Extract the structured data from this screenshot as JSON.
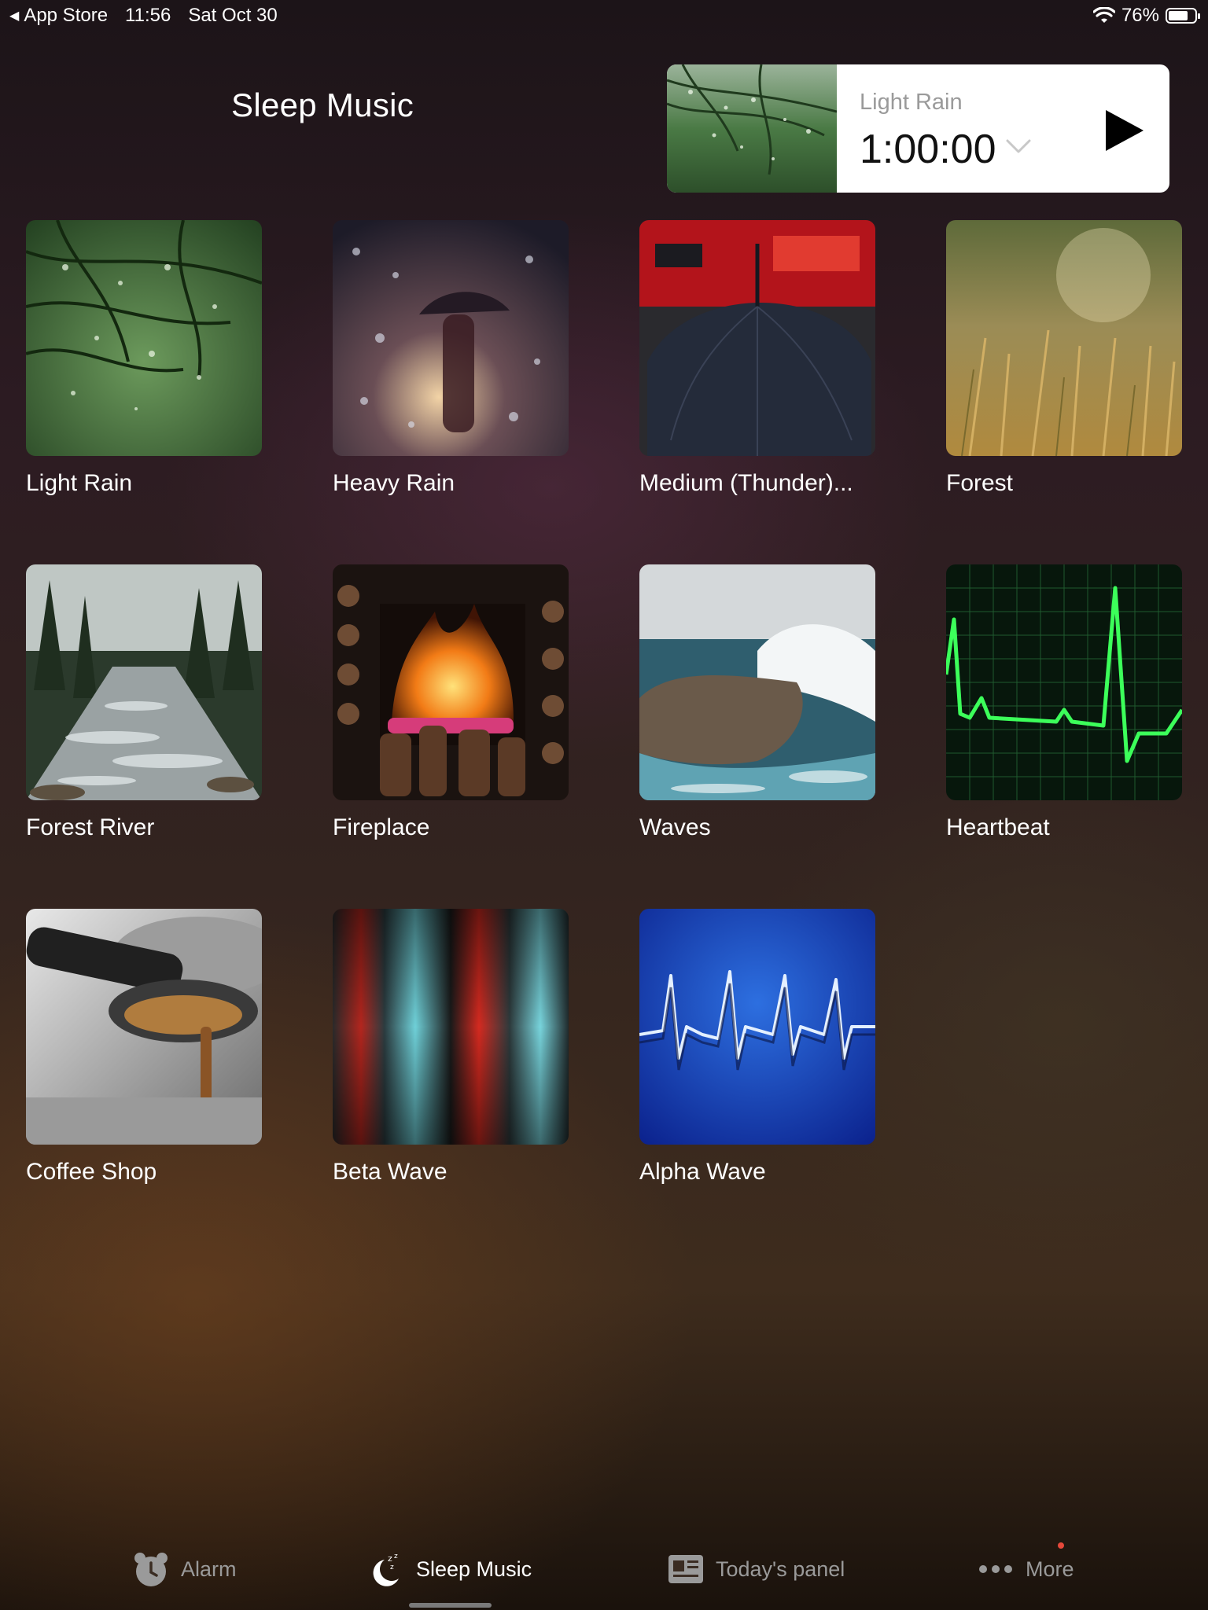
{
  "status_bar": {
    "back_app": "App Store",
    "time": "11:56",
    "date": "Sat Oct 30",
    "battery_percent": "76%",
    "battery_level": 0.76
  },
  "header": {
    "title": "Sleep Music"
  },
  "now_playing": {
    "track": "Light Rain",
    "duration": "1:00:00",
    "thumb_icon": "light-rain-thumbnail",
    "chevron_icon": "chevron-down-icon",
    "play_icon": "play-icon"
  },
  "sounds": [
    {
      "label": "Light Rain",
      "image": "rain-branches"
    },
    {
      "label": "Heavy Rain",
      "image": "rain-window-umbrella"
    },
    {
      "label": "Medium (Thunder)...",
      "image": "black-umbrella-red-bus"
    },
    {
      "label": "Forest",
      "image": "forest-grass-sunlight"
    },
    {
      "label": "Forest River",
      "image": "forest-stream"
    },
    {
      "label": "Fireplace",
      "image": "fireplace-logs"
    },
    {
      "label": "Waves",
      "image": "ocean-waves-rock"
    },
    {
      "label": "Heartbeat",
      "image": "green-ecg-grid"
    },
    {
      "label": "Coffee Shop",
      "image": "espresso-machine"
    },
    {
      "label": "Beta Wave",
      "image": "abstract-red-teal-wave"
    },
    {
      "label": "Alpha Wave",
      "image": "blue-ecg-wave"
    }
  ],
  "tab_bar": {
    "tabs": [
      {
        "label": "Alarm",
        "icon": "bear-clock-icon",
        "active": false
      },
      {
        "label": "Sleep Music",
        "icon": "moon-zzz-icon",
        "active": true
      },
      {
        "label": "Today's panel",
        "icon": "newspaper-icon",
        "active": false
      },
      {
        "label": "More",
        "icon": "more-dots-icon",
        "active": false
      }
    ]
  },
  "colors": {
    "accent_badge": "#e5483a",
    "inactive_tab": "#9a9a9a",
    "active_tab": "#ffffff"
  }
}
